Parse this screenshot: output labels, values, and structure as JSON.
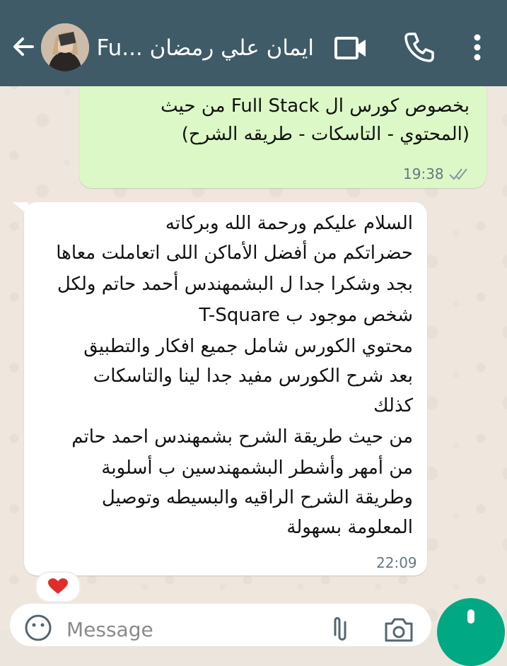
{
  "header": {
    "contact_name": "ايمان علي رمضان ...Fu",
    "icons": [
      "back-arrow-icon",
      "video-call-icon",
      "phone-icon",
      "more-options-icon"
    ]
  },
  "messages": [
    {
      "direction": "outgoing",
      "lines": [
        "بخصوص كورس ال Full Stack  من حيث",
        "(المحتوي - التاسكات - طريقه الشرح)"
      ],
      "time": "19:38",
      "status": "delivered"
    },
    {
      "direction": "incoming",
      "lines": [
        "السلام عليكم ورحمة الله وبركاته",
        "حضراتكم من أفضل الأماكن اللى اتعاملت معاها",
        "بجد وشكرا جدا ل البشمهندس أحمد حاتم ولكل",
        "شخص موجود ب T-Square",
        " محتوي الكورس شامل جميع افكار والتطبيق",
        "بعد شرح الكورس مفيد جدا لينا والتاسكات",
        "كذلك",
        "من حيث طريقة الشرح بشمهندس احمد حاتم",
        "من أمهر وأشطر البشمهندسين ب أسلوبة",
        "وطريقة الشرح  الراقيه والبسيطه وتوصيل",
        "المعلومة بسهولة"
      ],
      "time": "22:09",
      "reaction": "heart"
    }
  ],
  "input": {
    "placeholder": "Message"
  },
  "colors": {
    "header": "#3f5b67",
    "outgoing_bubble": "#dcf8c6",
    "incoming_bubble": "#ffffff",
    "accent": "#00a884"
  }
}
